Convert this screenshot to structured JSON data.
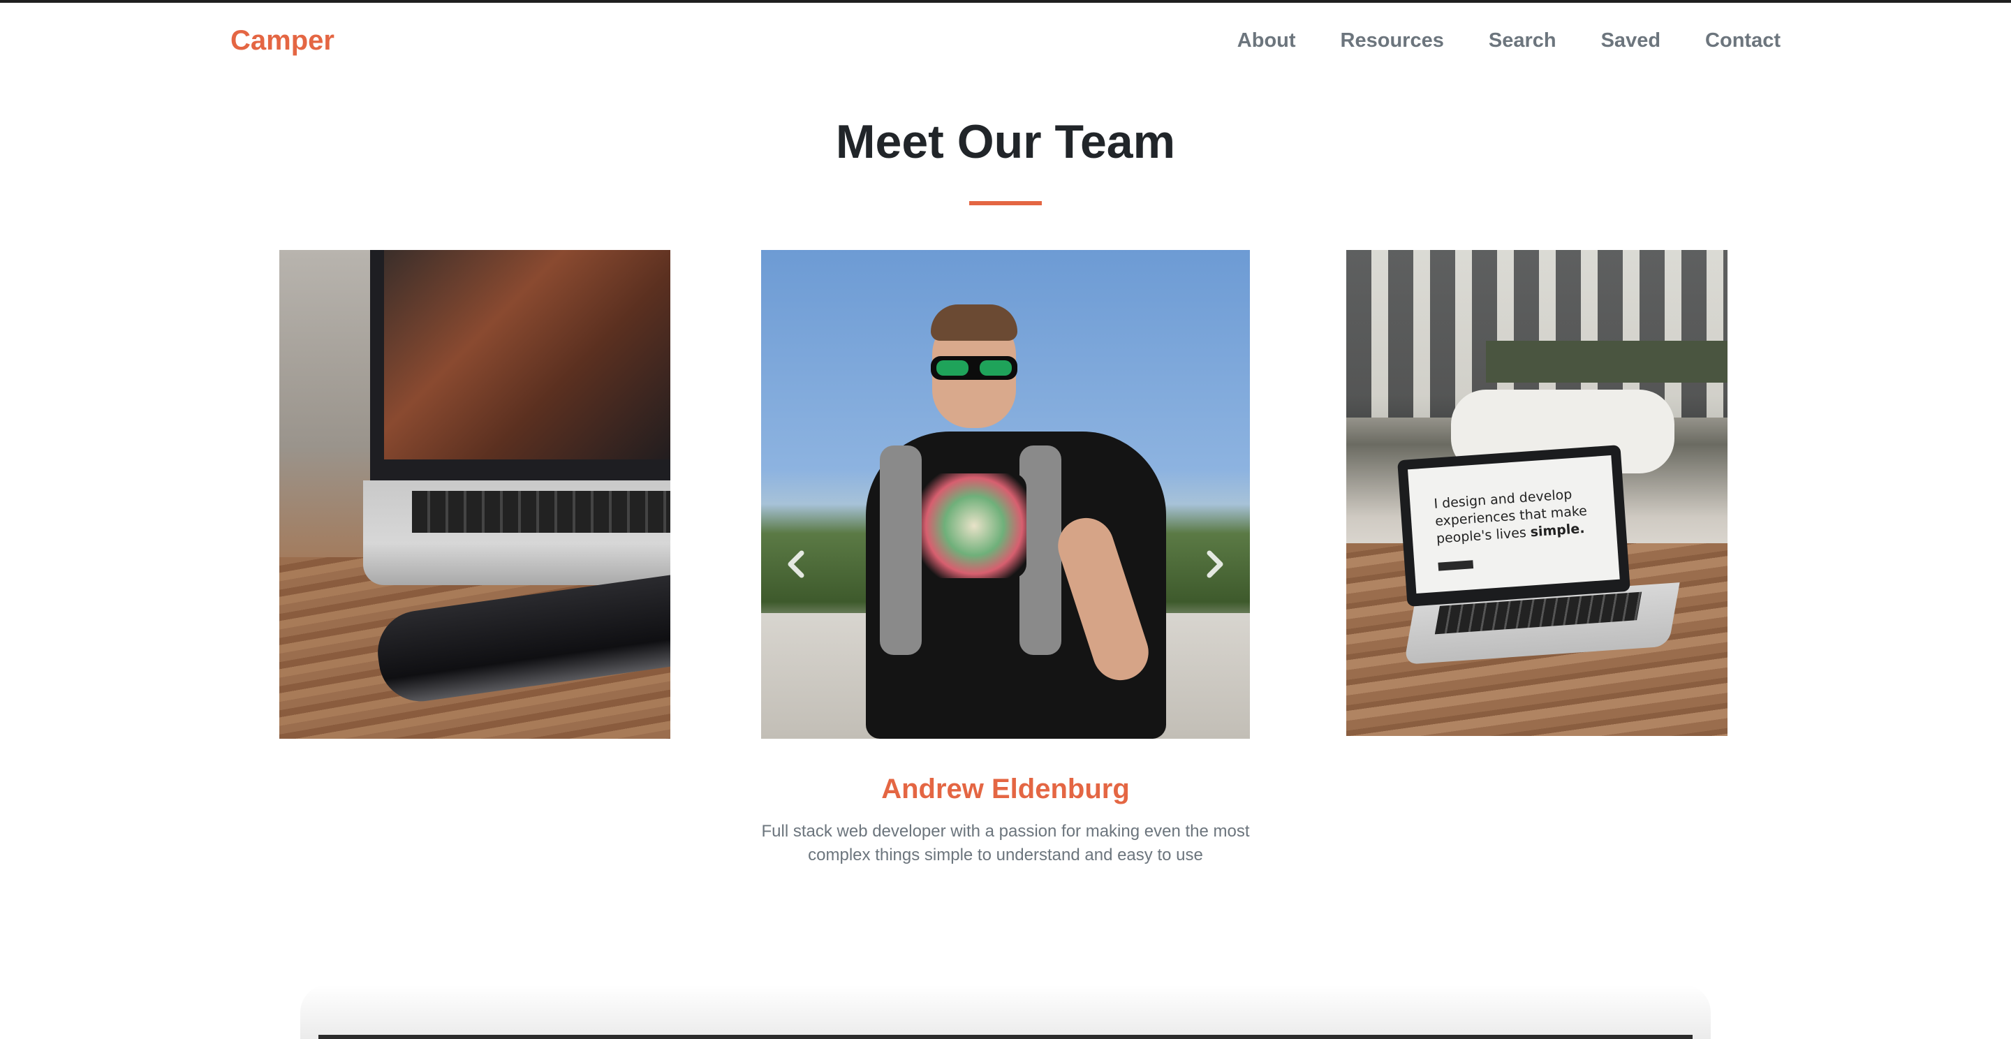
{
  "brand": "Camper",
  "nav": {
    "items": [
      "About",
      "Resources",
      "Search",
      "Saved",
      "Contact"
    ]
  },
  "team": {
    "title": "Meet Our Team",
    "member": {
      "name": "Andrew Eldenburg",
      "bio": "Full stack web developer with a passion for making even the most complex things simple to understand and easy to use"
    },
    "laptop_screen_text": {
      "line": "I design and develop experiences that make people's lives",
      "emphasis": "simple."
    }
  },
  "colors": {
    "accent": "#e46643",
    "heading": "#212529",
    "muted": "#6c757d"
  },
  "icons": {
    "prev": "chevron-left-icon",
    "next": "chevron-right-icon"
  }
}
